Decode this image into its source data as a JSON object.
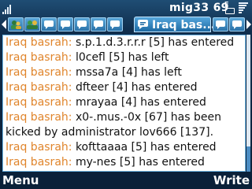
{
  "status": {
    "app_title": "mig33 69",
    "battery_label": "E"
  },
  "tabs": {
    "active_label": "Iraq bas..."
  },
  "chat": {
    "lines": [
      {
        "sender": "Iraq basrah:",
        "text": " s.p.1.d.3.r.r.r [5] has entered"
      },
      {
        "sender": "Iraq basrah:",
        "text": " l0cefl [5] has left"
      },
      {
        "sender": "Iraq basrah:",
        "text": " mssa7a [4] has left"
      },
      {
        "sender": "Iraq basrah:",
        "text": " dfteer [4] has entered"
      },
      {
        "sender": "Iraq basrah:",
        "text": " mrayaa [4] has entered"
      },
      {
        "sender": "Iraq basrah:",
        "text": " x0-.mus.-0x [67] has been"
      },
      {
        "sender": "",
        "text": "kicked by administrator lov666 [137]."
      },
      {
        "sender": "Iraq basrah:",
        "text": " kofttaaaa [5] has entered"
      },
      {
        "sender": "Iraq basrah:",
        "text": " my-nes [5] has entered"
      }
    ]
  },
  "softkeys": {
    "left": "Menu",
    "right": "Write"
  },
  "colors": {
    "sender": "#e0852c",
    "header_bg": "#1f4d74",
    "chat_bg": "#ffffff"
  }
}
